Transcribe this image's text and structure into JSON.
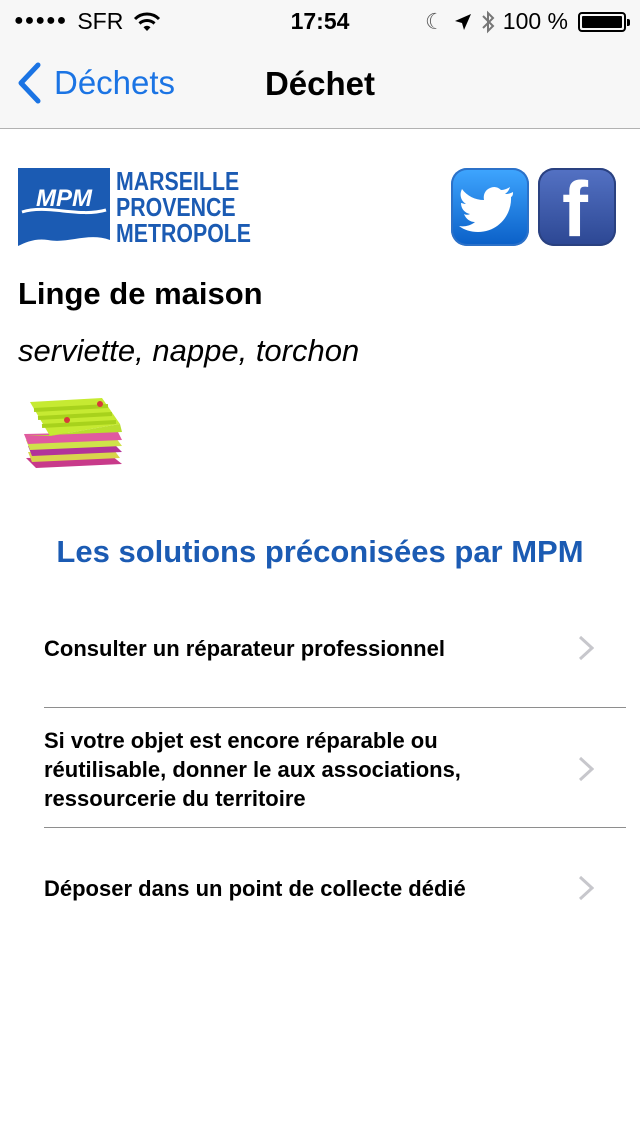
{
  "status_bar": {
    "carrier": "SFR",
    "time": "17:54",
    "battery": "100 %"
  },
  "nav": {
    "back_label": "Déchets",
    "title": "Déchet"
  },
  "logo": {
    "box_text": "MPM",
    "lines": [
      "MARSEILLE",
      "PROVENCE",
      "METROPOLE"
    ]
  },
  "item": {
    "name": "Linge de maison",
    "examples": "serviette, nappe, torchon"
  },
  "solutions": {
    "title": "Les solutions préconisées par MPM",
    "items": [
      {
        "label": "Consulter un réparateur professionnel"
      },
      {
        "label": "Si votre objet est encore réparable ou réutilisable, donner le aux associations, ressourcerie du territoire"
      },
      {
        "label": "Déposer dans un point de collecte dédié"
      }
    ]
  },
  "colors": {
    "accent_blue": "#1b74e4",
    "brand_blue": "#1b5bb3"
  },
  "icons": [
    "signal-dots-icon",
    "wifi-icon",
    "moon-icon",
    "location-arrow-icon",
    "bluetooth-icon",
    "battery-icon",
    "back-chevron-icon",
    "twitter-icon",
    "facebook-icon",
    "chevron-right-icon"
  ]
}
